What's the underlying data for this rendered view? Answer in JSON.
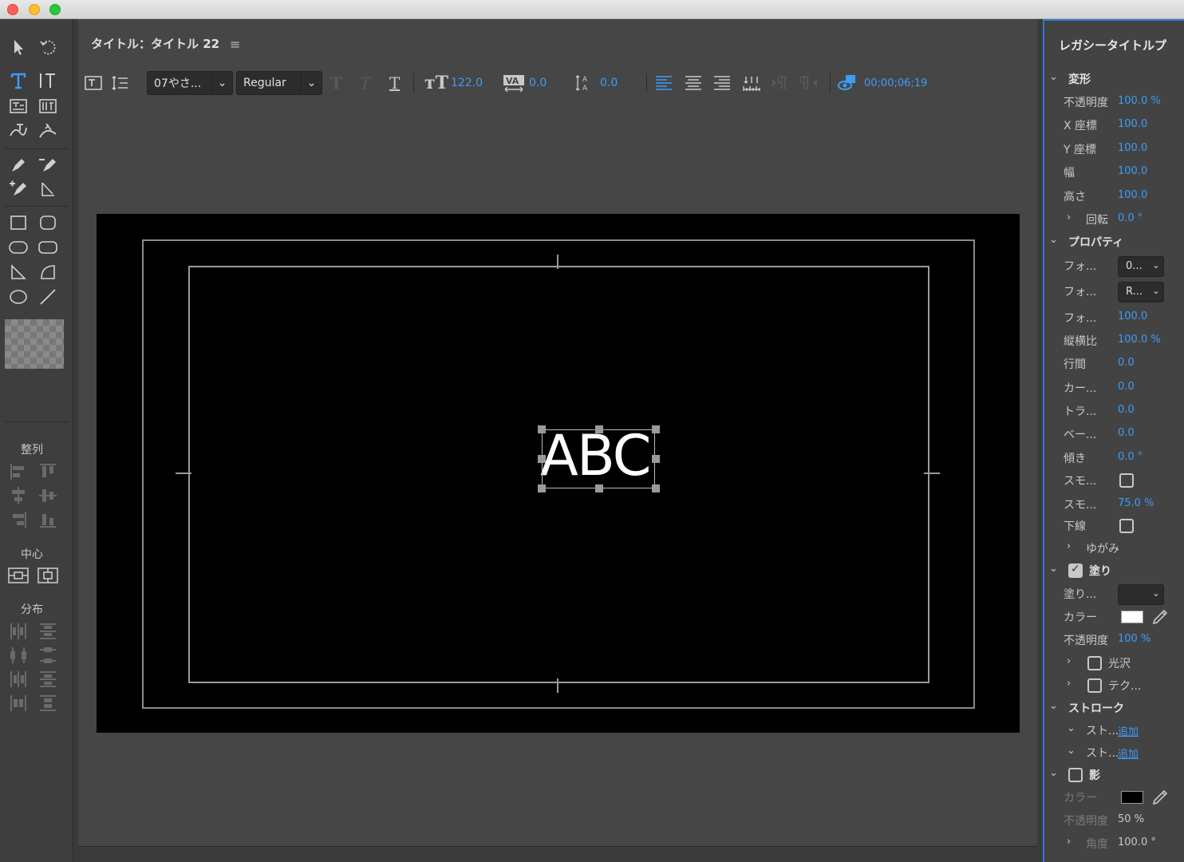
{
  "window": {
    "traffic_lights": [
      "close",
      "minimize",
      "zoom"
    ]
  },
  "toolbox": {
    "align_label": "整列",
    "center_label": "中心",
    "distribute_label": "分布"
  },
  "main": {
    "title": "タイトル：タイトル 22",
    "font_family": "07やさ...",
    "font_style": "Regular",
    "font_size": "122.0",
    "kerning": "0.0",
    "leading": "0.0",
    "timecode": "00;00;06;19",
    "canvas_text": "ABC"
  },
  "properties": {
    "title": "レガシータイトルプ",
    "transform": {
      "label": "変形",
      "opacity_label": "不透明度",
      "opacity": "100.0 %",
      "x_label": "X 座標",
      "x": "100.0",
      "y_label": "Y 座標",
      "y": "100.0",
      "width_label": "幅",
      "width": "100.0",
      "height_label": "高さ",
      "height": "100.0",
      "rotation_label": "回転",
      "rotation": "0.0 °"
    },
    "props": {
      "label": "プロパティ",
      "font_family_label": "フォ...",
      "font_family": "0...",
      "font_style_label": "フォ...",
      "font_style": "R...",
      "font_size_label": "フォ...",
      "font_size": "100.0",
      "aspect_label": "縦横比",
      "aspect": "100.0 %",
      "leading_label": "行間",
      "leading": "0.0",
      "kerning_label": "カー...",
      "kerning": "0.0",
      "tracking_label": "トラ...",
      "tracking": "0.0",
      "baseline_label": "ベー...",
      "baseline": "0.0",
      "slant_label": "傾き",
      "slant": "0.0 °",
      "smallcaps_label": "スモ...",
      "smallcaps_size_label": "スモ...",
      "smallcaps_size": "75.0 %",
      "underline_label": "下線",
      "distort_label": "ゆがみ"
    },
    "fill": {
      "label": "塗り",
      "type_label": "塗り...",
      "color_label": "カラー",
      "color": "#ffffff",
      "opacity_label": "不透明度",
      "opacity": "100 %",
      "sheen_label": "光沢",
      "texture_label": "テク..."
    },
    "stroke": {
      "label": "ストローク",
      "inner_label": "スト...",
      "inner_add": "追加",
      "outer_label": "スト...",
      "outer_add": "追加"
    },
    "shadow": {
      "label": "影",
      "color_label": "カラー",
      "color": "#000000",
      "opacity_label": "不透明度",
      "opacity": "50 %",
      "angle_label": "角度",
      "angle": "100.0 °"
    }
  }
}
